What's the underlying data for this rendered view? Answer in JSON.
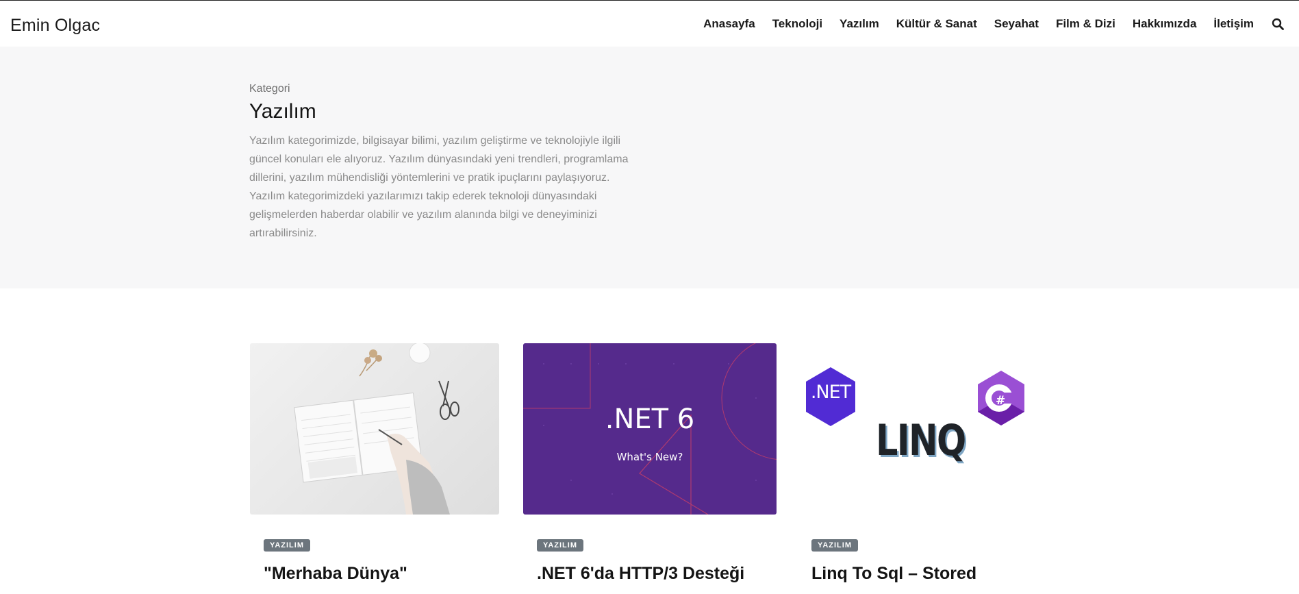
{
  "site": {
    "brand": "Emin Olgac"
  },
  "nav": {
    "items": [
      "Anasayfa",
      "Teknoloji",
      "Yazılım",
      "Kültür & Sanat",
      "Seyahat",
      "Film & Dizi",
      "Hakkımızda",
      "İletişim"
    ],
    "search_icon": "search-icon"
  },
  "category": {
    "eyebrow": "Kategori",
    "title": "Yazılım",
    "description": "Yazılım kategorimizde, bilgisayar bilimi, yazılım geliştirme ve teknolojiyle ilgili güncel konuları ele alıyoruz. Yazılım dünyasındaki yeni trendleri, programlama dillerini, yazılım mühendisliği yöntemlerini ve pratik ipuçlarını paylaşıyoruz. Yazılım kategorimizdeki yazılarımızı takip ederek teknoloji dünyasındaki gelişmelerden haberdar olabilir ve yazılım alanında bilgi ve deneyiminizi artırabilirsiniz."
  },
  "posts": [
    {
      "badge": "YAZILIM",
      "title": "\"Merhaba Dünya\"",
      "image": "notebook-writing-photo"
    },
    {
      "badge": "YAZILIM",
      "title": ".NET 6'da HTTP/3 Desteği",
      "image": "dotnet6-banner",
      "image_text": ".NET 6",
      "image_subtext": "What's New?"
    },
    {
      "badge": "YAZILIM",
      "title": "Linq To Sql – Stored",
      "image": "linq-logos",
      "image_text": "LINQ",
      "image_logo_net": ".NET",
      "image_logo_cs": "#"
    }
  ],
  "colors": {
    "hero_bg": "#f7f7f8",
    "badge_bg": "#6c757d",
    "net_purple": "#552a8c"
  }
}
